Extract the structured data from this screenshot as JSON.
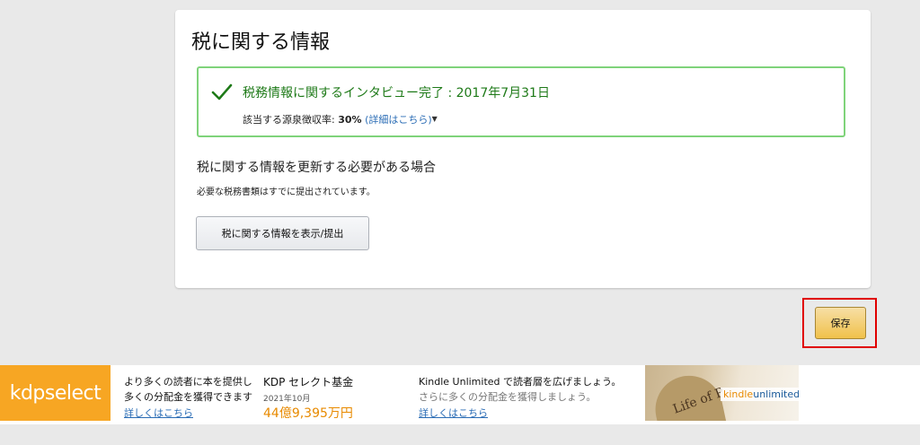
{
  "tax_card": {
    "title": "税に関する情報",
    "success_title": "税務情報に関するインタビュー完了 : 2017年7月31日",
    "rate_label": "該当する源泉徴収率:",
    "rate_value": "30%",
    "details_link": "(詳細はこちら)",
    "update_heading": "税に関する情報を更新する必要がある場合",
    "update_sub": "必要な税務書類はすでに提出されています。",
    "view_button": "税に関する情報を表示/提出"
  },
  "save_button": "保存",
  "banner": {
    "logo_left": "kdp",
    "logo_right": "select",
    "promo_line1": "より多くの読者に本を提供し",
    "promo_line2": "多くの分配金を獲得できます",
    "promo_link": "詳しくはこちら",
    "fund_title": "KDP セレクト基金",
    "fund_date": "2021年10月",
    "fund_amount": "44億9,395万円",
    "ku_title": "Kindle Unlimited で読者層を広げましょう。",
    "ku_sub": "さらに多くの分配金を獲得しましょう。",
    "ku_link": "詳しくはこちら",
    "ku_logo_k": "kindle",
    "ku_logo_u": "unlimited",
    "book_text": "Life of P"
  },
  "colors": {
    "success_green": "#1e7a18",
    "success_border": "#7fd37a",
    "link_blue": "#2a6cb5",
    "kdp_orange": "#f7a623",
    "highlight_red": "#e00000"
  },
  "icons": {
    "check": "check-icon",
    "caret": "caret-down-icon"
  }
}
